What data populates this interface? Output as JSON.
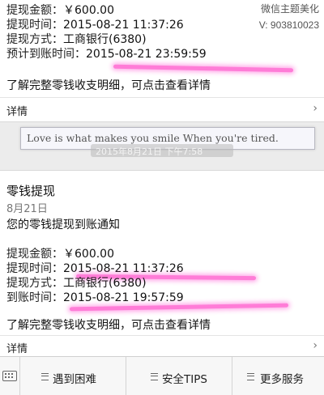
{
  "top_card": {
    "amount_label": "提现金额：",
    "amount_value": "￥600.00",
    "time_label": "提现时间：",
    "time_value": "2015-08-21 11:37:26",
    "method_label": "提现方式：",
    "method_value": "工商银行(6380)",
    "expected_label": "预计到账时间：",
    "expected_value": "2015-08-21 23:59:59",
    "summary_text": "了解完整零钱收支明细，可点击查看详情",
    "details_label": "详情"
  },
  "watermark": {
    "line1": "微信主题美化",
    "line2": "V: 903810023"
  },
  "signature": {
    "text": "Love is what makes you smile When you're tired.",
    "timestamp": "2015年8月21日 下午7:58"
  },
  "bottom_card": {
    "title": "零钱提现",
    "date": "8月21日",
    "notice": "您的零钱提现到账通知",
    "amount_label": "提现金额：",
    "amount_value": "￥600.00",
    "time_label": "提现时间：",
    "time_value": "2015-08-21 11:37:26",
    "method_label": "提现方式：",
    "method_value": "工商银行(6380)",
    "arrival_label": "到账时间：",
    "arrival_value": "2015-08-21 19:57:59",
    "summary_text": "了解完整零钱收支明细，可点击查看详情",
    "details_label": "详情"
  },
  "menu": {
    "items": [
      {
        "label": "遇到困难"
      },
      {
        "label": "安全TIPS"
      },
      {
        "label": "更多服务"
      }
    ]
  },
  "colors": {
    "highlight": "#ff6ed3"
  },
  "icons": {
    "chevron": "chevron-right-icon",
    "keyboard": "keyboard-icon",
    "menu": "menu-icon"
  }
}
